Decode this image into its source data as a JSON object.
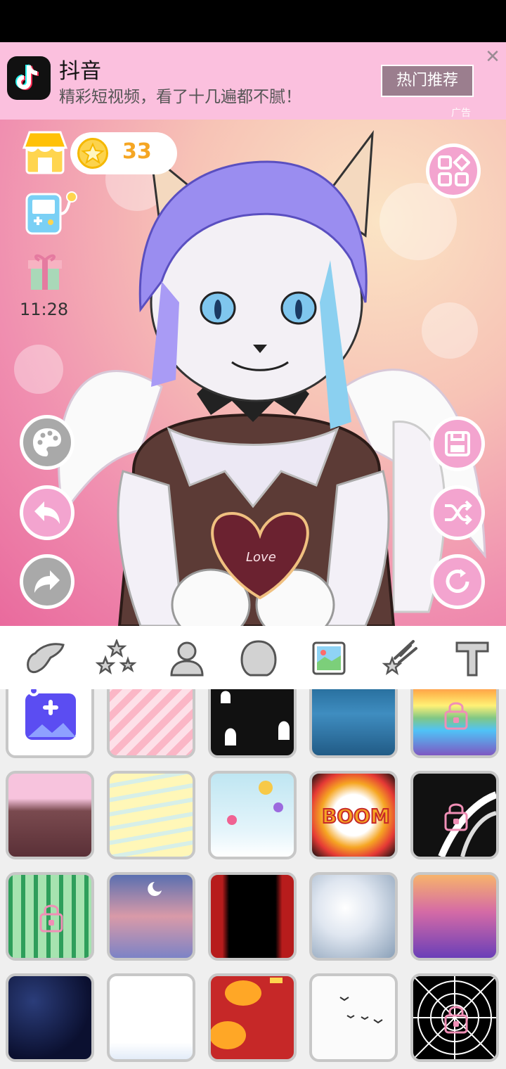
{
  "ad": {
    "app_name": "抖音",
    "description": "精彩短视频，看了十几遍都不腻！",
    "button_label": "热门推荐",
    "close_symbol": "✕",
    "ad_mark": "广告"
  },
  "hud": {
    "coins": "33",
    "timer": "11:28"
  },
  "canvas": {
    "heart_text": "Love"
  },
  "toolbar": {
    "items": [
      "wings-icon",
      "stars-icon",
      "person-icon",
      "head-icon",
      "background-icon",
      "shooting-star-icon",
      "text-icon"
    ],
    "selected": "background-icon"
  },
  "grid": {
    "tiles": [
      {
        "name": "add-custom-background",
        "locked": false
      },
      {
        "name": "pink-stripes",
        "locked": false
      },
      {
        "name": "ghosts-black",
        "locked": false
      },
      {
        "name": "underwater-blue",
        "locked": false
      },
      {
        "name": "rainbow",
        "locked": true
      },
      {
        "name": "pink-rock",
        "locked": false
      },
      {
        "name": "yellow-waves",
        "locked": false
      },
      {
        "name": "balloons-sky",
        "locked": false
      },
      {
        "name": "boom-comic",
        "locked": false
      },
      {
        "name": "black-swirl",
        "locked": true
      },
      {
        "name": "bamboo",
        "locked": true
      },
      {
        "name": "moon-clouds",
        "locked": false
      },
      {
        "name": "red-curtain",
        "locked": false
      },
      {
        "name": "silver-bokeh",
        "locked": false
      },
      {
        "name": "purple-sparkle",
        "locked": false
      },
      {
        "name": "starry-night",
        "locked": false
      },
      {
        "name": "white-waves",
        "locked": false
      },
      {
        "name": "red-lanterns",
        "locked": false
      },
      {
        "name": "birds-white",
        "locked": false
      },
      {
        "name": "spider-web",
        "locked": true
      }
    ]
  },
  "colors": {
    "accent_pink": "#f3a4cf",
    "grey_button": "#a9a9a9",
    "ad_background": "#fbc0de"
  }
}
